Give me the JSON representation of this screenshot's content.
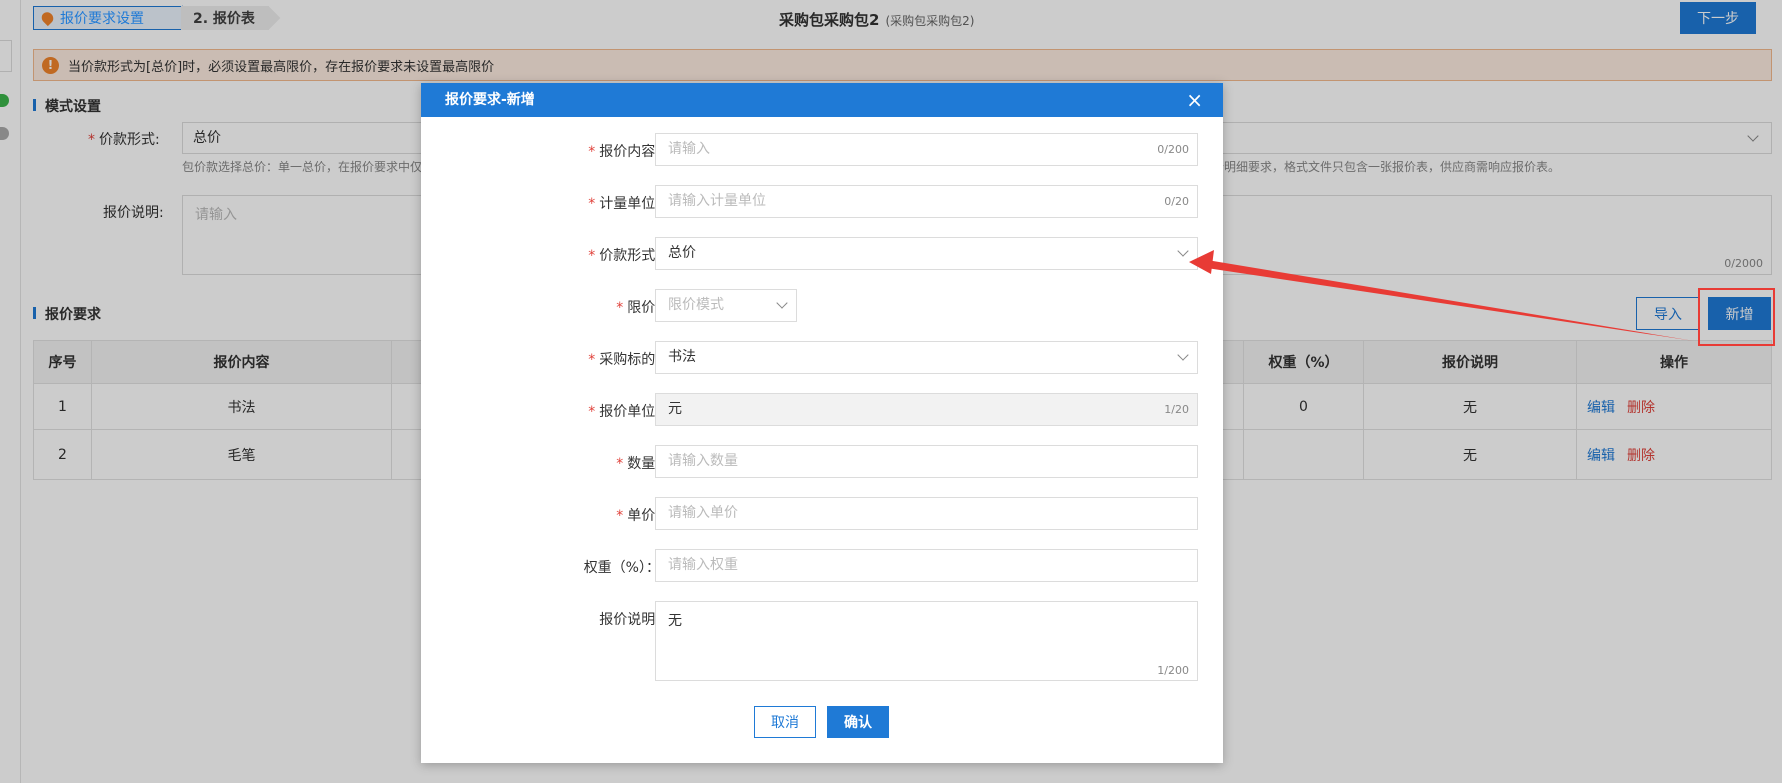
{
  "header": {
    "step1": "报价要求设置",
    "step2": "2. 报价表",
    "package_title": "采购包采购包2",
    "package_sub": "(采购包采购包2)",
    "next_button": "下一步"
  },
  "warning": {
    "icon": "!",
    "text": "当价款形式为[总价]时，必须设置最高限价，存在报价要求未设置最高限价"
  },
  "mode_section": {
    "title": "模式设置",
    "price_form_label": "价款形式:",
    "price_form_value": "总价",
    "hint_left": "包价款选择总价：单一总价，在报价要求中仅",
    "hint_right": "报价明细要求，格式文件只包含一张报价表，供应商需响应报价表。",
    "remark_label": "报价说明:",
    "remark_placeholder": "请输入",
    "remark_count": "0/2000"
  },
  "requirements": {
    "title": "报价要求",
    "import_button": "导入",
    "add_button": "新增",
    "columns": [
      "序号",
      "报价内容",
      "权重（%）",
      "报价说明",
      "操作"
    ],
    "rows": [
      {
        "index": "1",
        "content": "书法",
        "weight": "0",
        "remark": "无",
        "edit": "编辑",
        "delete": "删除"
      },
      {
        "index": "2",
        "content": "毛笔",
        "weight": "",
        "remark": "无",
        "edit": "编辑",
        "delete": "删除"
      }
    ]
  },
  "modal": {
    "title": "报价要求-新增",
    "close": "×",
    "fields": {
      "content": {
        "label": "报价内容:",
        "placeholder": "请输入",
        "count": "0/200"
      },
      "unit": {
        "label": "计量单位:",
        "placeholder": "请输入计量单位",
        "count": "0/20"
      },
      "price_form": {
        "label": "价款形式:",
        "value": "总价"
      },
      "limit": {
        "label": "限价:",
        "placeholder": "限价模式"
      },
      "target": {
        "label": "采购标的:",
        "value": "书法"
      },
      "price_unit": {
        "label": "报价单位:",
        "value": "元",
        "count": "1/20"
      },
      "quantity": {
        "label": "数量:",
        "placeholder": "请输入数量"
      },
      "unit_price": {
        "label": "单价:",
        "placeholder": "请输入单价"
      },
      "weight": {
        "label": "权重（%）：",
        "placeholder": "请输入权重"
      },
      "remark": {
        "label": "报价说明:",
        "value": "无",
        "count": "1/200"
      }
    },
    "cancel_button": "取消",
    "confirm_button": "确认"
  },
  "colors": {
    "primary": "#1f7ad6",
    "danger": "#e0413a",
    "warning": "#f0842b",
    "annotation": "#e83b35"
  }
}
